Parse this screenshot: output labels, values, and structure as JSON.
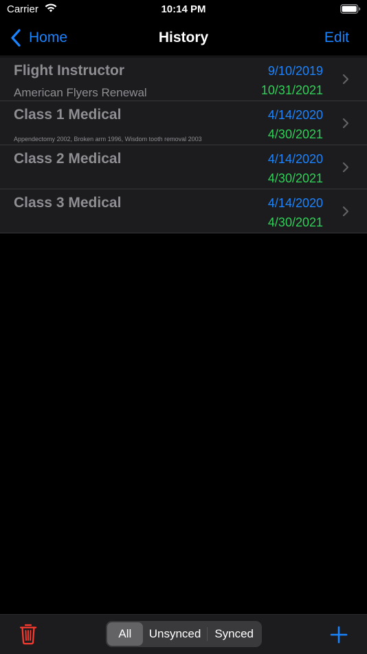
{
  "status_bar": {
    "carrier": "Carrier",
    "time": "10:14 PM",
    "icons": [
      "wifi-icon",
      "battery-icon"
    ]
  },
  "nav": {
    "back_label": "Home",
    "title": "History",
    "edit_label": "Edit"
  },
  "rows": [
    {
      "title": "Flight Instructor",
      "subtitle": "American Flyers Renewal",
      "date_top": "9/10/2019",
      "date_bottom": "10/31/2021"
    },
    {
      "title": "Class 1 Medical",
      "subtitle": "Appendectomy 2002, Broken arm 1996, Wisdom tooth removal 2003",
      "date_top": "4/14/2020",
      "date_bottom": "4/30/2021"
    },
    {
      "title": "Class 2 Medical",
      "subtitle": "",
      "date_top": "4/14/2020",
      "date_bottom": "4/30/2021"
    },
    {
      "title": "Class 3 Medical",
      "subtitle": "",
      "date_top": "4/14/2020",
      "date_bottom": "4/30/2021"
    }
  ],
  "toolbar": {
    "segments": [
      "All",
      "Unsynced",
      "Synced"
    ],
    "selected_segment": "All",
    "icons": [
      "trash-icon",
      "plus-icon"
    ]
  },
  "colors": {
    "accent": "#1a84ff",
    "date_top": "#1a84ff",
    "date_bottom": "#30d158",
    "trash": "#ff3b30",
    "row_text": "#8e8e93"
  }
}
